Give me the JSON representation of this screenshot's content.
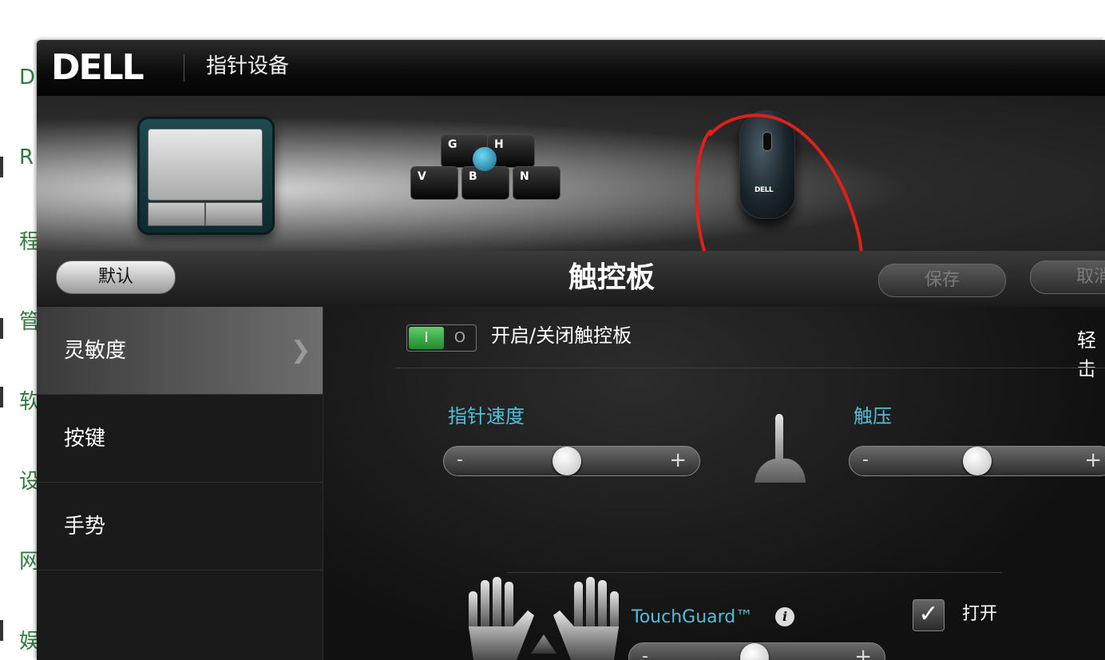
{
  "background_letters": [
    "D",
    "R",
    "程",
    "管",
    "软",
    "设",
    "网",
    "娱"
  ],
  "window": {
    "logo": "DELL",
    "title": "指针设备"
  },
  "devices": {
    "mouse_logo": "DELL",
    "keyboard_keys": [
      "G",
      "H",
      "V",
      "B",
      "N"
    ]
  },
  "toolbar": {
    "default_label": "默认",
    "panel_title": "触控板",
    "save_label": "保存",
    "cancel_label": "取消"
  },
  "sidebar": {
    "items": [
      {
        "label": "灵敏度",
        "active": true
      },
      {
        "label": "按键",
        "active": false
      },
      {
        "label": "手势",
        "active": false
      }
    ]
  },
  "content": {
    "toggle": {
      "on_text": "I",
      "off_text": "O",
      "label": "开启/关闭触控板"
    },
    "clipped_label": "轻击",
    "pointer_speed": {
      "label": "指针速度",
      "minus": "-",
      "plus": "+",
      "value": 0.48
    },
    "touch_pressure": {
      "label": "触压",
      "minus": "-",
      "plus": "+",
      "value": 0.48
    },
    "touchguard": {
      "label": "TouchGuard™",
      "minus": "-",
      "plus": "+",
      "value": 0.49
    },
    "enable_checkbox": {
      "checked": true,
      "label": "打开",
      "check_mark": "✓"
    },
    "info_glyph": "i"
  },
  "colors": {
    "accent_label": "#4fc0d8",
    "toggle_on": "#2f9a3c",
    "annotation_circle": "#e0201a",
    "background_letters": "#2f7a3a"
  }
}
